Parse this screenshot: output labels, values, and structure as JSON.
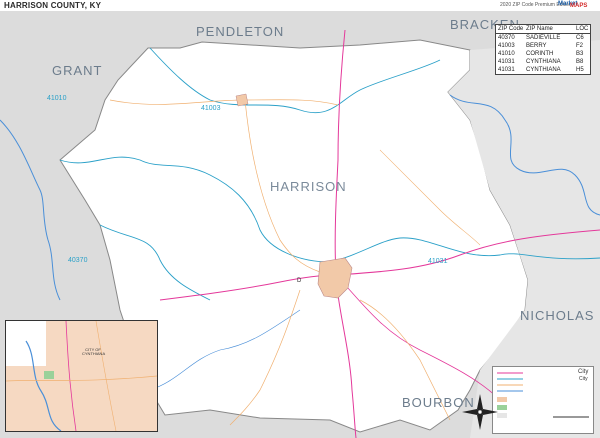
{
  "header": {
    "title": "HARRISON COUNTY, KY",
    "edition": "2020 ZIP Code Premium Edition",
    "logo_line1": "Market",
    "logo_line2": "MAPS"
  },
  "zip_table": {
    "columns": [
      "ZIP Code",
      "ZIP Name",
      "LOC"
    ],
    "rows": [
      [
        "40370",
        "SADIEVILLE",
        "C6"
      ],
      [
        "41003",
        "BERRY",
        "F2"
      ],
      [
        "41010",
        "CORINTH",
        "B3"
      ],
      [
        "41031",
        "CYNTHIANA",
        "B8"
      ],
      [
        "41031",
        "CYNTHIANA",
        "H5"
      ]
    ]
  },
  "counties": {
    "pendleton": "PENDLETON",
    "bracken": "BRACKEN",
    "grant": "GRANT",
    "harrison": "HARRISON",
    "nicholas": "NICHOLAS",
    "bourbon": "BOURBON"
  },
  "zips": {
    "z41003": "41003",
    "z41010": "41010",
    "z41031": "41031",
    "z40370": "40370"
  },
  "inset": {
    "label": "CITY OF CYNTHIANA"
  },
  "legend": {
    "city_title": "City",
    "city_sub": "City",
    "town": "D"
  },
  "colors": {
    "county_bg": "#ffffff",
    "outer_bg": "#dcdcdc",
    "zip_boundary": "#2aa0c8",
    "highway": "#e4389a",
    "road": "#f0b070",
    "city_fill": "#f2c9a8",
    "water": "#4a8fd8"
  }
}
